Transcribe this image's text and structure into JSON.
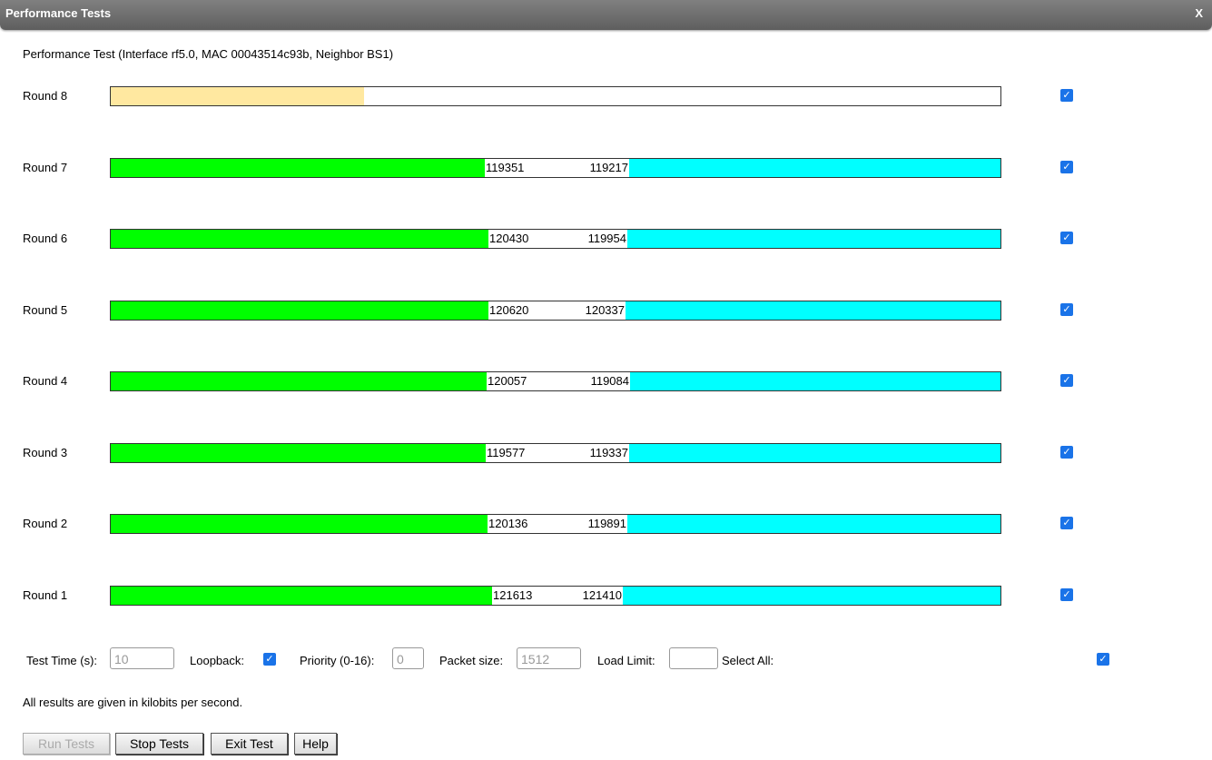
{
  "window": {
    "title": "Performance Tests",
    "close_label": "X"
  },
  "subtitle": "Performance Test (Interface rf5.0, MAC 00043514c93b, Neighbor BS1)",
  "colors": {
    "downstream": "#00ff00",
    "upstream": "#00ffff",
    "progress": "#ffe8a0",
    "checkbox": "#1a73e8"
  },
  "rounds": [
    {
      "label": "Round 8",
      "in_progress": true,
      "progress": 0.285,
      "down": "",
      "up": "",
      "checked": true
    },
    {
      "label": "Round 7",
      "in_progress": false,
      "down": "119351",
      "up": "119217",
      "checked": true
    },
    {
      "label": "Round 6",
      "in_progress": false,
      "down": "120430",
      "up": "119954",
      "checked": true
    },
    {
      "label": "Round 5",
      "in_progress": false,
      "down": "120620",
      "up": "120337",
      "checked": true
    },
    {
      "label": "Round 4",
      "in_progress": false,
      "down": "120057",
      "up": "119084",
      "checked": true
    },
    {
      "label": "Round 3",
      "in_progress": false,
      "down": "119577",
      "up": "119337",
      "checked": true
    },
    {
      "label": "Round 2",
      "in_progress": false,
      "down": "120136",
      "up": "119891",
      "checked": true
    },
    {
      "label": "Round 1",
      "in_progress": false,
      "down": "121613",
      "up": "121410",
      "checked": true
    }
  ],
  "controls": {
    "test_time_label": "Test Time (s):",
    "test_time_value": "10",
    "loopback_label": "Loopback:",
    "loopback_checked": true,
    "priority_label": "Priority (0-16):",
    "priority_value": "0",
    "packet_size_label": "Packet size:",
    "packet_size_value": "1512",
    "load_limit_label": "Load Limit:",
    "load_limit_value": "",
    "select_all_label": "Select All:",
    "select_all_checked": true
  },
  "note": "All results are given in kilobits per second.",
  "buttons": {
    "run": "Run Tests",
    "stop": "Stop Tests",
    "exit": "Exit Test",
    "help": "Help"
  },
  "check_glyph": "✓"
}
